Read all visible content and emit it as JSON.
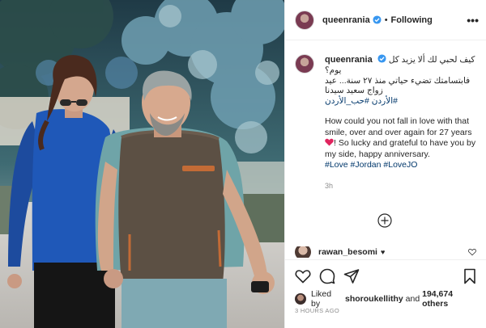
{
  "post": {
    "username": "queenrania",
    "follow_status": "Following",
    "header_separator": "•",
    "more_label": "•••"
  },
  "caption": {
    "username": "queenrania",
    "arabic_line1": "كيف لحبي لك ألا يزيد كل",
    "arabic_line2": "يوم؟",
    "arabic_line3": "فابتسامتك تضيء حياتي منذ ٢٧ سنة... عيد",
    "arabic_line4": "زواج سعيد سيدنا",
    "arabic_tags": "#الأردن #حب_الأردن",
    "english_text_before_heart": "How could you not fall in love with that smile, over and over again for 27 years",
    "english_text_after_heart": "! So lucky and grateful to have you by my side, happy anniversary.",
    "english_tags": "#Love #Jordan #LoveJO",
    "time": "3h"
  },
  "comment": {
    "username": "rawan_besomi",
    "text": "♥"
  },
  "likes": {
    "prefix": "Liked by",
    "liker": "shoroukellithy",
    "connector": "and",
    "count": "194,674 others"
  },
  "footer": {
    "posted_ago": "3 HOURS AGO"
  },
  "icons": {
    "verified": "verified-badge-icon",
    "add": "add-comments-icon",
    "like": "heart-icon",
    "comment": "comment-icon",
    "share": "share-icon",
    "save": "bookmark-icon"
  },
  "colors": {
    "verified": "#3897f0",
    "link": "#00376b",
    "muted": "#8e8e8e",
    "red_heart": "#e0245e"
  }
}
